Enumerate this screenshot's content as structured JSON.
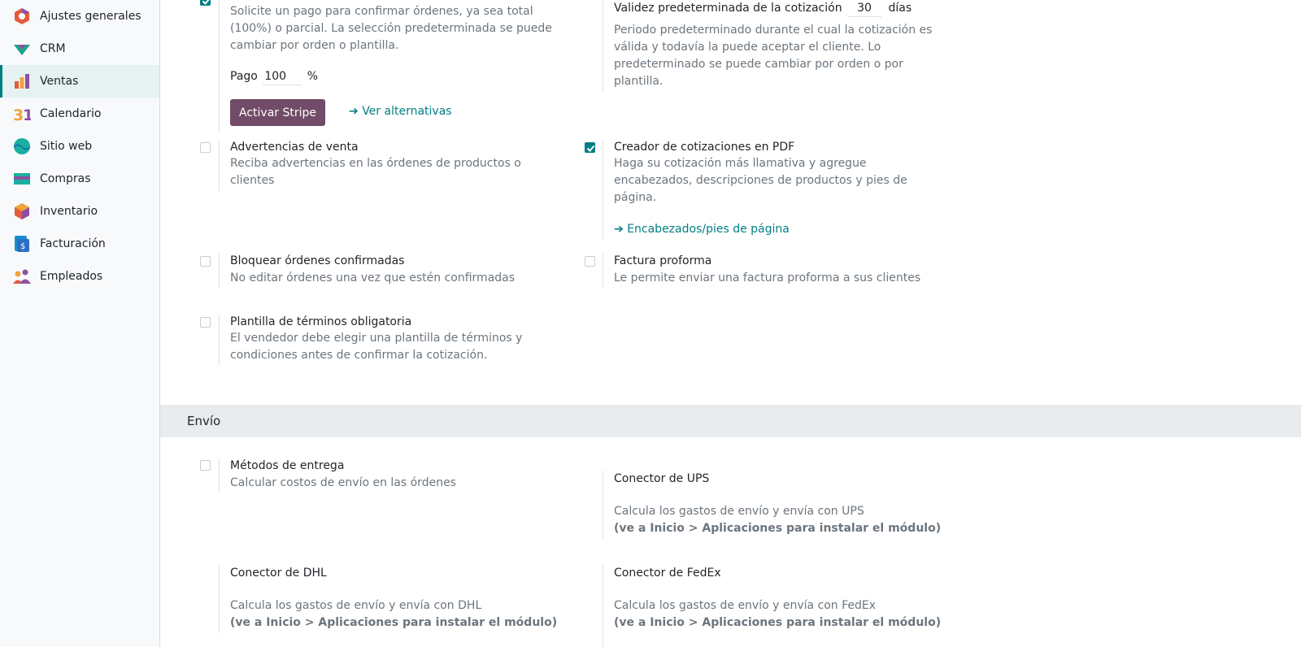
{
  "sidebar": {
    "items": [
      {
        "label": "Ajustes generales",
        "icon": "general-settings-icon"
      },
      {
        "label": "CRM",
        "icon": "crm-icon"
      },
      {
        "label": "Ventas",
        "icon": "sales-icon",
        "active": true
      },
      {
        "label": "Calendario",
        "icon": "calendar-icon"
      },
      {
        "label": "Sitio web",
        "icon": "website-icon"
      },
      {
        "label": "Compras",
        "icon": "purchase-icon"
      },
      {
        "label": "Inventario",
        "icon": "inventory-icon"
      },
      {
        "label": "Facturación",
        "icon": "invoicing-icon"
      },
      {
        "label": "Empleados",
        "icon": "employees-icon"
      }
    ]
  },
  "online_payment": {
    "desc": "Solicite un pago para confirmar órdenes, ya sea total (100%) o parcial. La selección predeterminada se puede cambiar por orden o plantilla.",
    "pago_label": "Pago",
    "pago_value": "100",
    "pago_unit": "%",
    "activate_button": "Activar Stripe",
    "alternatives_link": "Ver alternativas"
  },
  "quotation_validity": {
    "label": "Validez predeterminada de la cotización",
    "value": "30",
    "unit": "días",
    "desc": "Periodo predeterminado durante el cual la cotización es válida y todavía la puede aceptar el cliente. Lo predeterminado se puede cambiar por orden o por plantilla."
  },
  "sale_warnings": {
    "title": "Advertencias de venta",
    "desc": "Reciba advertencias en las órdenes de productos o clientes",
    "checked": false
  },
  "pdf_builder": {
    "title": "Creador de cotizaciones en PDF",
    "desc": "Haga su cotización más llamativa y agregue encabezados, descripciones de productos y pies de página.",
    "link": "Encabezados/pies de página",
    "checked": true
  },
  "lock_orders": {
    "title": "Bloquear órdenes confirmadas",
    "desc": "No editar órdenes una vez que estén confirmadas",
    "checked": false
  },
  "proforma": {
    "title": "Factura proforma",
    "desc": "Le permite enviar una factura proforma a sus clientes",
    "checked": false
  },
  "terms_template": {
    "title": "Plantilla de términos obligatoria",
    "desc": "El vendedor debe elegir una plantilla de términos y condiciones antes de confirmar la cotización.",
    "checked": false
  },
  "shipping": {
    "section_title": "Envío",
    "delivery_methods": {
      "title": "Métodos de entrega",
      "desc": "Calcular costos de envío en las órdenes",
      "checked": false
    },
    "ups": {
      "title": "Conector de UPS",
      "desc": "Calcula los gastos de envío y envía con UPS",
      "note": "(ve a Inicio > Aplicaciones para instalar el módulo)"
    },
    "dhl": {
      "title": "Conector de DHL",
      "desc": "Calcula los gastos de envío y envía con DHL",
      "note": "(ve a Inicio > Aplicaciones para instalar el módulo)"
    },
    "fedex": {
      "title": "Conector de FedEx",
      "desc": "Calcula los gastos de envío y envía con FedEx",
      "note": "(ve a Inicio > Aplicaciones para instalar el módulo)"
    }
  },
  "colors": {
    "accent": "#017e84",
    "primary_button": "#714b67",
    "section_bar": "#e9ecef"
  }
}
